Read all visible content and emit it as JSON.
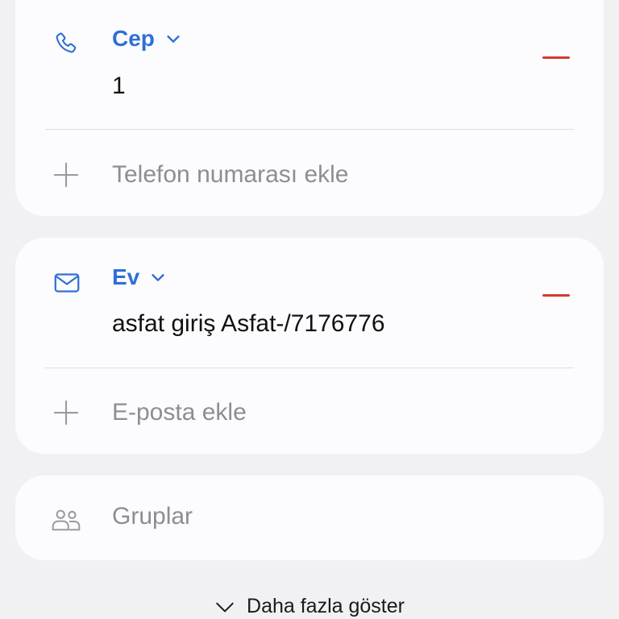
{
  "phone": {
    "type_label": "Cep",
    "value": "1",
    "add_label": "Telefon numarası ekle"
  },
  "email": {
    "type_label": "Ev",
    "value": "asfat giriş Asfat-/7176776",
    "add_label": "E-posta ekle"
  },
  "groups": {
    "label": "Gruplar"
  },
  "show_more": {
    "label": "Daha fazla göster"
  },
  "colors": {
    "accent": "#2f6fd6",
    "remove": "#d43a2f",
    "placeholder": "#8d8d92",
    "card": "#fcfcfe",
    "background": "#f1f1f3"
  },
  "icons": {
    "phone": "phone-icon",
    "email": "mail-icon",
    "groups": "people-icon",
    "add": "plus-icon",
    "expand": "chevron-down-icon",
    "remove": "minus-icon"
  }
}
